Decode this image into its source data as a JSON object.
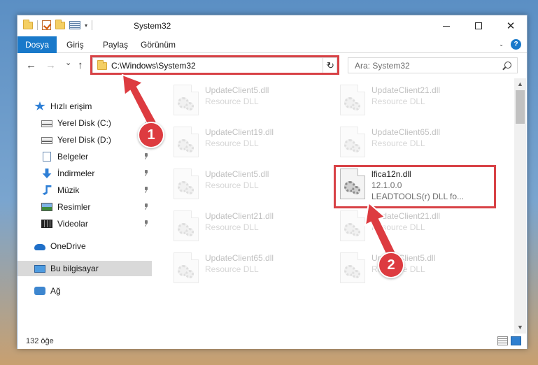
{
  "window": {
    "title": "System32",
    "controls": {
      "minimize": "",
      "maximize": "",
      "close": "✕"
    }
  },
  "ribbon": {
    "tabs": [
      {
        "label": "Dosya"
      },
      {
        "label": "Giriş"
      },
      {
        "label": "Paylaş"
      },
      {
        "label": "Görünüm"
      }
    ],
    "help": "?"
  },
  "nav": {
    "back": "←",
    "forward": "→",
    "recent": "⌄",
    "up": "↑",
    "address": "C:\\Windows\\System32",
    "refresh": "↻",
    "search_placeholder": "Ara: System32"
  },
  "sidebar": {
    "items": [
      {
        "label": "Hızlı erişim",
        "icon": "star-icon",
        "pinned": false
      },
      {
        "label": "Yerel Disk (C:)",
        "icon": "drive-icon",
        "pinned": true
      },
      {
        "label": "Yerel Disk (D:)",
        "icon": "drive-icon",
        "pinned": false
      },
      {
        "label": "Belgeler",
        "icon": "document-icon",
        "pinned": true
      },
      {
        "label": "İndirmeler",
        "icon": "download-icon",
        "pinned": true
      },
      {
        "label": "Müzik",
        "icon": "music-icon",
        "pinned": true
      },
      {
        "label": "Resimler",
        "icon": "picture-icon",
        "pinned": true
      },
      {
        "label": "Videolar",
        "icon": "video-icon",
        "pinned": true
      },
      {
        "label": "OneDrive",
        "icon": "cloud-icon",
        "pinned": false
      },
      {
        "label": "Bu bilgisayar",
        "icon": "computer-icon",
        "pinned": false,
        "selected": true
      },
      {
        "label": "Ağ",
        "icon": "network-icon",
        "pinned": false
      }
    ]
  },
  "files": [
    {
      "name": "UpdateClient5.dll",
      "type": "Resource DLL",
      "faded": true
    },
    {
      "name": "UpdateClient21.dll",
      "type": "Resource DLL",
      "faded": true
    },
    {
      "name": "UpdateClient19.dll",
      "type": "Resource DLL",
      "faded": true
    },
    {
      "name": "UpdateClient65.dll",
      "type": "Resource DLL",
      "faded": true
    },
    {
      "name": "UpdateClient5.dll",
      "type": "Resource DLL",
      "faded": true
    },
    {
      "name": "lfica12n.dll",
      "version": "12.1.0.0",
      "type": "LEADTOOLS(r) DLL fo...",
      "faded": false
    },
    {
      "name": "UpdateClient21.dll",
      "type": "Resource DLL",
      "faded": true
    },
    {
      "name": "UpdateClient21.dll",
      "type": "Resource DLL",
      "faded": true
    },
    {
      "name": "UpdateClient65.dll",
      "type": "Resource DLL",
      "faded": true
    },
    {
      "name": "UpdateClient5.dll",
      "type": "Resource DLL",
      "faded": true
    }
  ],
  "status": {
    "item_count": "132 öğe"
  },
  "annotations": {
    "badge1": "1",
    "badge2": "2",
    "color": "#dd3b40"
  }
}
